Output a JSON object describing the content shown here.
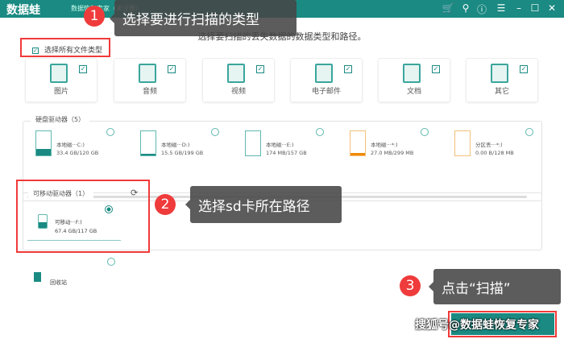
{
  "app": {
    "logo": "数据蛙",
    "title": "数据恢复专家（未注册）",
    "header_icons": [
      "cart-icon",
      "key-icon",
      "help-icon",
      "menu-icon",
      "minimize-icon",
      "maximize-icon",
      "close-icon"
    ]
  },
  "subtitle": "选择要扫描的丢失数据的数据类型和路径。",
  "select_all": {
    "label": "选择所有文件类型",
    "checked": true
  },
  "file_types": [
    {
      "label": "图片",
      "icon": "image-icon",
      "checked": true
    },
    {
      "label": "音频",
      "icon": "music-icon",
      "checked": true
    },
    {
      "label": "视频",
      "icon": "video-icon",
      "checked": true
    },
    {
      "label": "电子邮件",
      "icon": "email-icon",
      "checked": true
    },
    {
      "label": "文档",
      "icon": "document-icon",
      "checked": true
    },
    {
      "label": "其它",
      "icon": "other-icon",
      "checked": true
    }
  ],
  "hard_drives": {
    "label": "硬盘驱动器（5）",
    "items": [
      {
        "name": "本地磁···C:)",
        "size": "33.4 GB/120 GB",
        "used": 0.28,
        "color": "#1a8a82"
      },
      {
        "name": "本地磁···D:)",
        "size": "15.5 GB/199 GB",
        "used": 0.08,
        "color": "#1a8a82"
      },
      {
        "name": "本地磁···E:)",
        "size": "174 MB/157 GB",
        "used": 0.0,
        "color": "#1a8a82"
      },
      {
        "name": "本地磁···*:)",
        "size": "27.0 MB/299 MB",
        "used": 0.09,
        "color": "#ef8a00"
      },
      {
        "name": "分区丢···*:)",
        "size": "0.00  B/128 MB",
        "used": 0.0,
        "color": "#ef8a00"
      }
    ]
  },
  "removable": {
    "label": "可移动驱动器（1）",
    "items": [
      {
        "name": "可移动···F:)",
        "size": "67.4 GB/117 GB",
        "selected": true
      }
    ]
  },
  "recycle_bin": {
    "label": "回收站"
  },
  "callouts": [
    {
      "num": "1",
      "text": "选择要进行扫描的类型"
    },
    {
      "num": "2",
      "text": "选择sd卡所在路径"
    },
    {
      "num": "3",
      "text": "点击“扫描”"
    }
  ],
  "watermark": "搜狐号@数据蛙恢复专家"
}
